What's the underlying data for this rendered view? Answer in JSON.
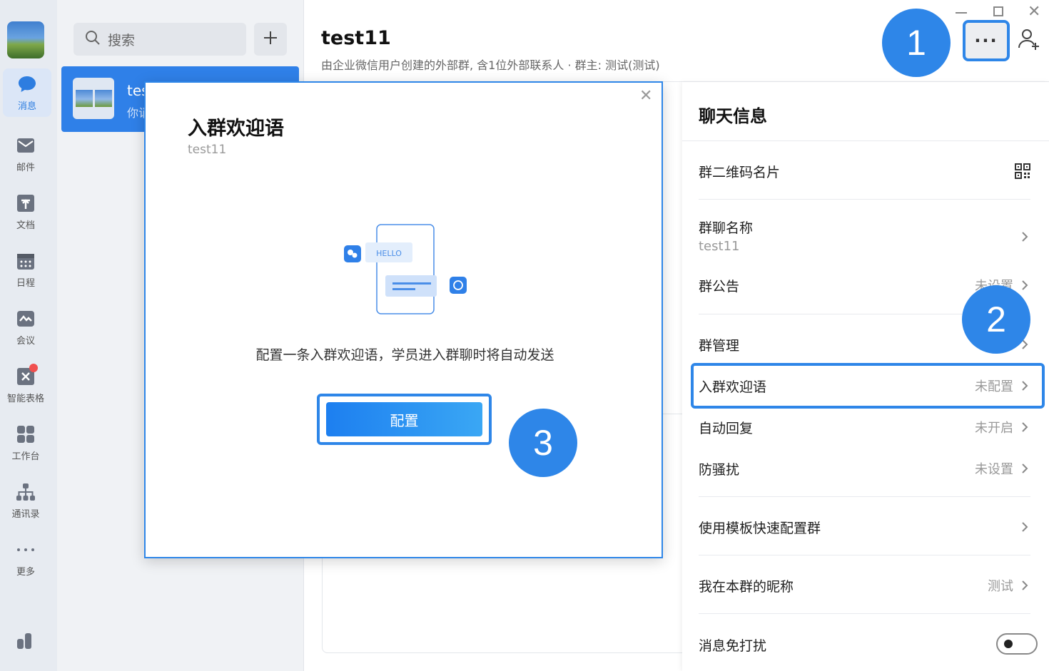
{
  "rail": {
    "items": [
      {
        "label": "消息",
        "icon": "chat-bubble-icon",
        "active": true
      },
      {
        "label": "邮件",
        "icon": "mail-icon"
      },
      {
        "label": "文档",
        "icon": "document-icon"
      },
      {
        "label": "日程",
        "icon": "calendar-icon"
      },
      {
        "label": "会议",
        "icon": "meeting-icon"
      },
      {
        "label": "智能表格",
        "icon": "smart-table-icon"
      },
      {
        "label": "工作台",
        "icon": "workbench-icon"
      },
      {
        "label": "通讯录",
        "icon": "contacts-icon"
      },
      {
        "label": "更多",
        "icon": "more-dots-icon"
      }
    ]
  },
  "convlist": {
    "search_placeholder": "搜索",
    "item": {
      "name": "tes",
      "preview": "你诮"
    }
  },
  "chat": {
    "title": "test11",
    "subtitle": "由企业微信用户创建的外部群, 含1位外部联系人 · 群主: 测试(测试)"
  },
  "panel": {
    "title": "聊天信息",
    "rows": {
      "qr": {
        "label": "群二维码名片"
      },
      "name": {
        "label": "群聊名称",
        "value": "test11"
      },
      "notice": {
        "label": "群公告",
        "value": "未设置"
      },
      "manage": {
        "label": "群管理"
      },
      "welcome": {
        "label": "入群欢迎语",
        "value": "未配置"
      },
      "autoreply": {
        "label": "自动回复",
        "value": "未开启"
      },
      "dnd": {
        "label": "防骚扰",
        "value": "未设置"
      },
      "template": {
        "label": "使用模板快速配置群"
      },
      "nickname": {
        "label": "我在本群的昵称",
        "value": "测试"
      },
      "mute": {
        "label": "消息免打扰",
        "on": false
      }
    }
  },
  "modal": {
    "title": "入群欢迎语",
    "subtitle": "test11",
    "illustration_text": "HELLO",
    "description": "配置一条入群欢迎语，学员进入群聊时将自动发送",
    "button": "配置"
  },
  "badges": [
    "1",
    "2",
    "3"
  ],
  "colors": {
    "accent": "#2e86e8",
    "selected_conv": "#2f80e8"
  }
}
